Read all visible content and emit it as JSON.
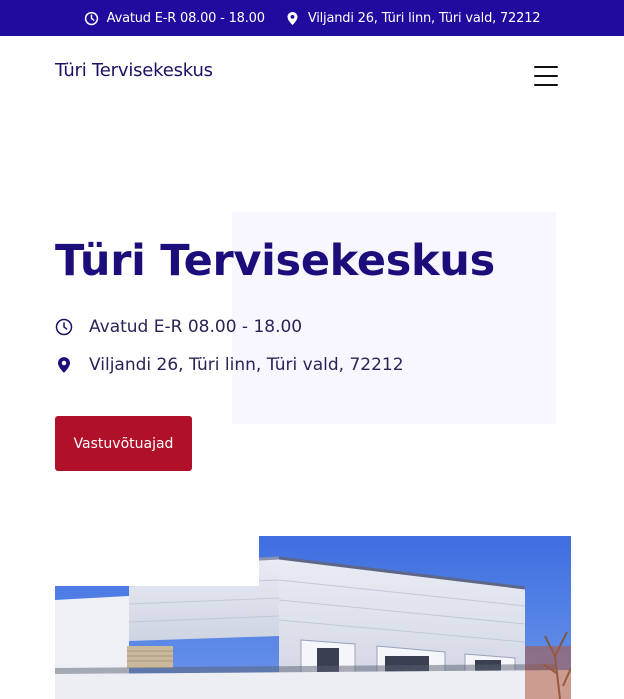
{
  "topbar": {
    "hours": "Avatud E-R 08.00 - 18.00",
    "address": "Viljandi 26, Türi linn, Türi vald, 72212",
    "hours_icon": "clock-icon",
    "address_icon": "map-pin-icon",
    "background": "#1f0b9e"
  },
  "header": {
    "brand": "Türi Tervisekeskus",
    "menu_icon": "hamburger-menu-icon"
  },
  "hero": {
    "title": "Türi Tervisekeskus",
    "hours": "Avatud E-R 08.00 - 18.00",
    "address": "Viljandi 26, Türi linn, Türi vald, 72212",
    "cta_label": "Vastuvõtuajad",
    "cta_color": "#b0102a"
  },
  "photo": {
    "alt": "building-photo"
  }
}
